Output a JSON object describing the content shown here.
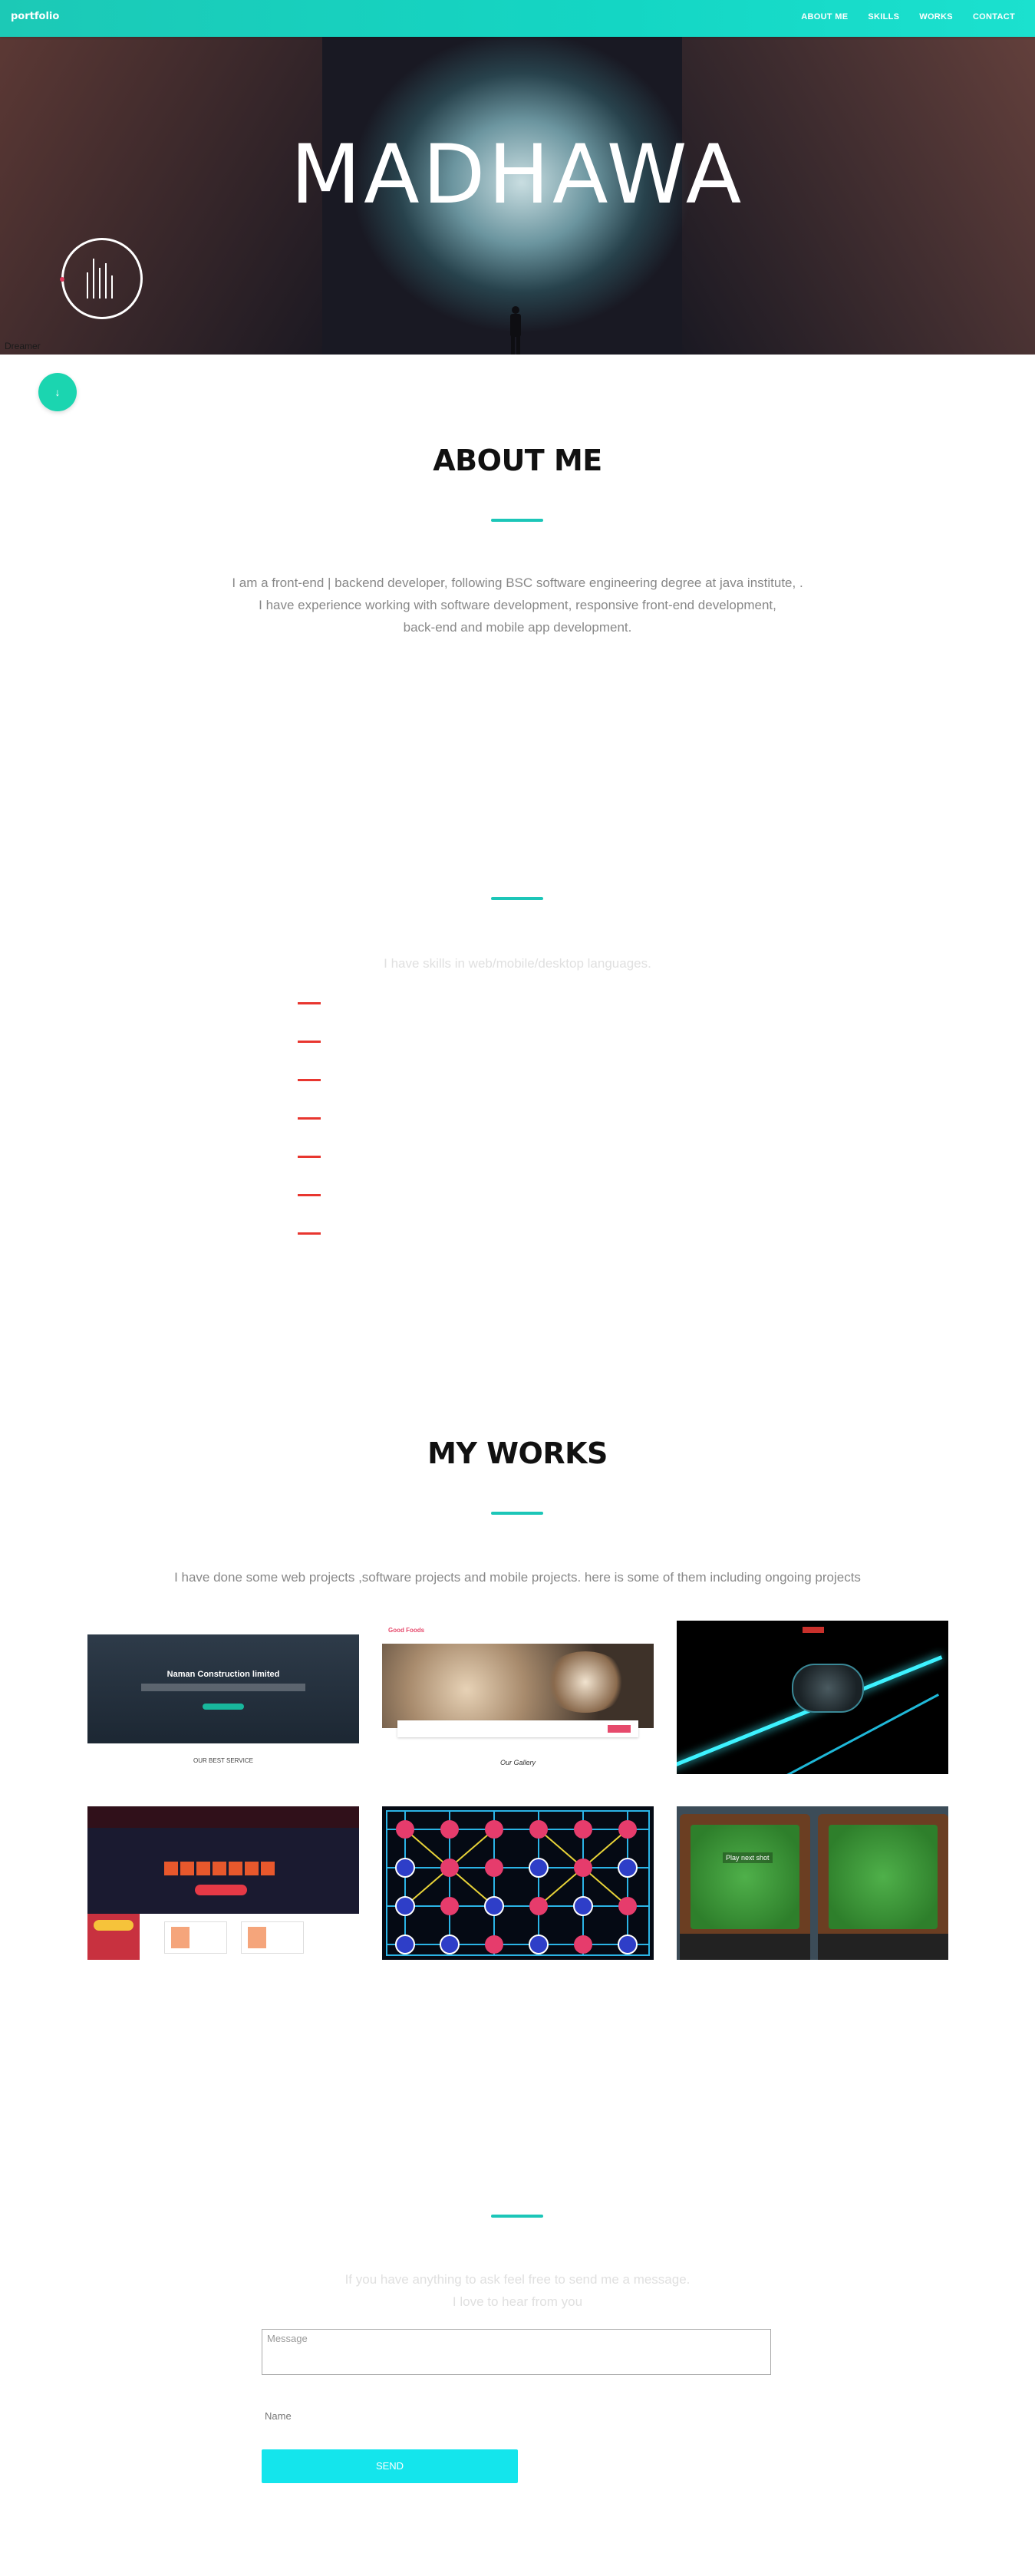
{
  "nav": {
    "brand": "portfolio",
    "links": [
      "ABOUT ME",
      "SKILLS",
      "WORKS",
      "CONTACT"
    ]
  },
  "hero": {
    "title": "MADHAWA",
    "caption": "Dreamer"
  },
  "about": {
    "title": "ABOUT ME",
    "lines": [
      "I am a front-end | backend developer, following BSC software engineering degree at java institute, .",
      "I have experience working with software development, responsive front-end development,",
      "back-end and mobile app development."
    ]
  },
  "skills": {
    "intro": "I have skills in web/mobile/desktop languages.",
    "count": 7
  },
  "works": {
    "title": "MY WORKS",
    "intro": "I have done some web projects ,software projects and mobile projects. here is some of them including ongoing projects",
    "items": [
      {
        "headline": "Naman Construction limited",
        "caption": "OUR BEST SERVICE"
      },
      {
        "headline": "Good Foods",
        "caption": "Our Gallery"
      },
      {
        "headline": ""
      },
      {
        "headline": ""
      },
      {
        "headline": ""
      },
      {
        "headline": "Play next shot"
      }
    ]
  },
  "contact": {
    "intro_line1": "If you have anything to ask feel free to send me a message.",
    "intro_line2": "I love to hear from you",
    "message_placeholder": "Message",
    "name_label": "Name",
    "send_label": "SEND"
  },
  "colors": {
    "accent": "#1cc6b8",
    "skill_bar": "#e8362f",
    "send_button": "#14e5ec"
  }
}
